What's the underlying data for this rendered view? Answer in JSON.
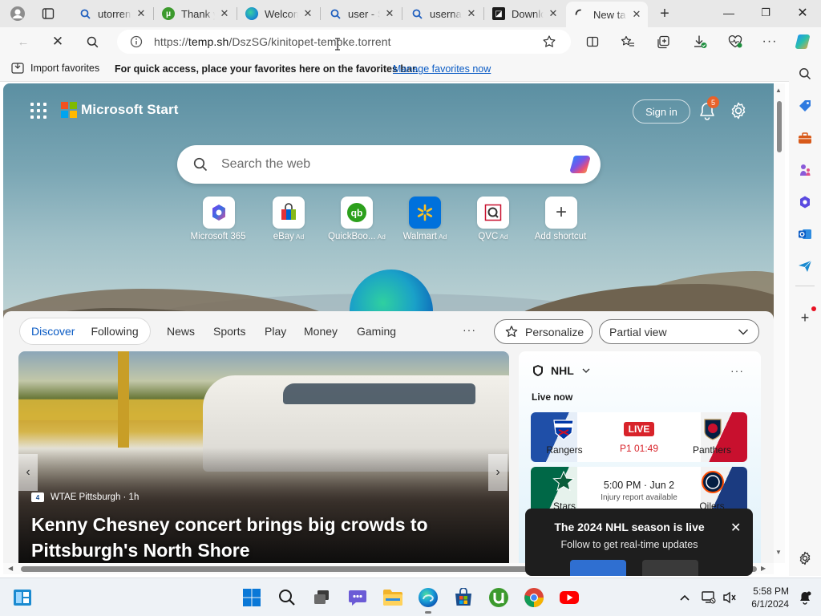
{
  "browser": {
    "tabs": [
      {
        "label": "utorrent",
        "favicon": "search-icon"
      },
      {
        "label": "Thank y",
        "favicon": "utorrent-icon"
      },
      {
        "label": "Welcom",
        "favicon": "edge-icon"
      },
      {
        "label": "user - S",
        "favicon": "search-icon"
      },
      {
        "label": "usernar",
        "favicon": "search-icon"
      },
      {
        "label": "Downlo",
        "favicon": "utorrent-icon"
      },
      {
        "label": "New ta",
        "favicon": "loading-icon",
        "active": true
      }
    ],
    "address": {
      "url_prefix": "https://",
      "url_domain": "temp.sh",
      "url_path": "/DszSG/kinitopet-tempke.torrent"
    },
    "favorites_bar": {
      "import_label": "Import favorites",
      "hint": "For quick access, place your favorites here on the favorites bar.",
      "manage_link": "Manage favorites now"
    }
  },
  "start": {
    "brand": "Microsoft Start",
    "sign_in": "Sign in",
    "notification_count": "5",
    "search_placeholder": "Search the web",
    "shortcuts": [
      {
        "label": "Microsoft 365",
        "ad": ""
      },
      {
        "label": "eBay",
        "ad": "Ad"
      },
      {
        "label": "QuickBoo...",
        "ad": "Ad"
      },
      {
        "label": "Walmart",
        "ad": "Ad"
      },
      {
        "label": "QVC",
        "ad": "Ad"
      },
      {
        "label": "Add shortcut",
        "ad": ""
      }
    ]
  },
  "feed": {
    "tabs": [
      "Discover",
      "Following"
    ],
    "nav": [
      "News",
      "Sports",
      "Play",
      "Money",
      "Gaming"
    ],
    "more": "···",
    "personalize": "Personalize",
    "view_select": "Partial view",
    "hero": {
      "source": "WTAE Pittsburgh · 1h",
      "source_badge": "4",
      "headline": "Kenny Chesney concert brings big crowds to Pittsburgh's North Shore"
    },
    "nhl": {
      "title": "NHL",
      "live_now": "Live now",
      "games": [
        {
          "home": "Rangers",
          "away": "Panthers",
          "status": "LIVE",
          "detail": "P1 01:49",
          "home_color": "#1f4fa8",
          "away_color": "#c8102e"
        },
        {
          "home": "Stars",
          "away": "Oilers",
          "status": "5:00 PM · Jun 2",
          "detail": "Injury report available",
          "home_color": "#006847",
          "away_color": "#1b3b80"
        }
      ],
      "toast": {
        "title": "The 2024 NHL season is live",
        "body": "Follow to get real-time updates"
      }
    }
  },
  "taskbar": {
    "time": "5:58 PM",
    "date": "6/1/2024"
  },
  "colors": {
    "accent": "#0a5bc4",
    "live_red": "#d8232a",
    "badge_orange": "#e8622a"
  }
}
